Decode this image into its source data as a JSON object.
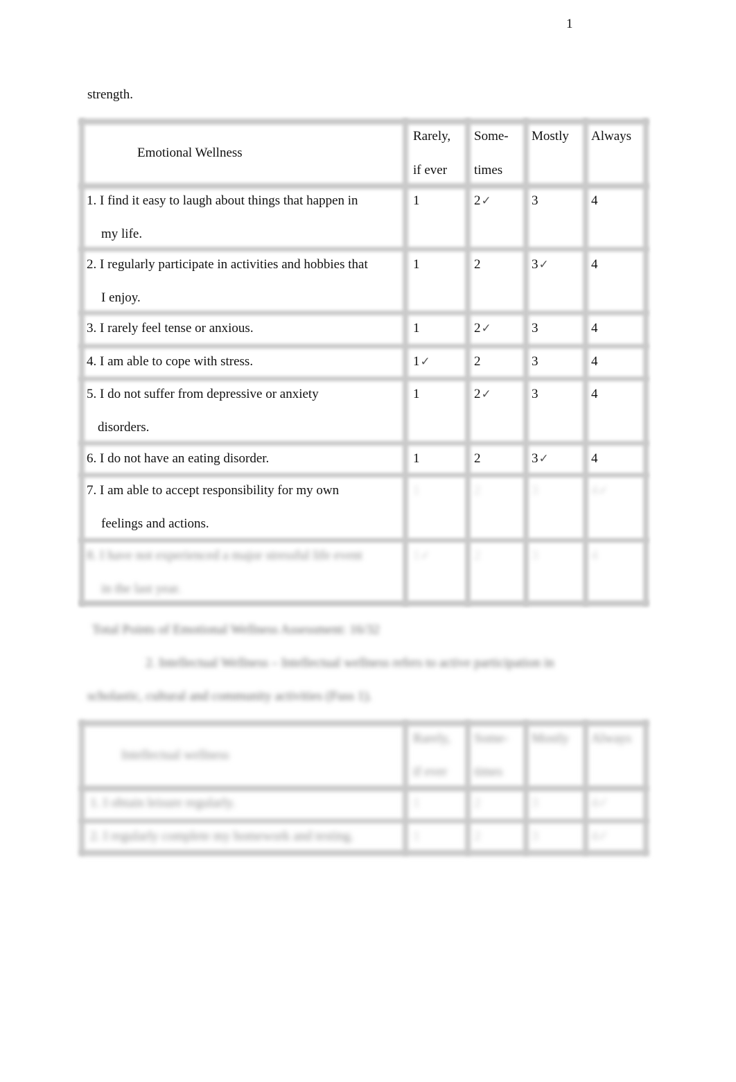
{
  "page": {
    "number": "1",
    "intro_text": "strength."
  },
  "emotional_table": {
    "title": "Emotional Wellness",
    "columns": [
      {
        "line1": "Rarely,",
        "line2": "if ever"
      },
      {
        "line1": "Some-",
        "line2": "times"
      },
      {
        "line1": "Mostly",
        "line2": ""
      },
      {
        "line1": "Always",
        "line2": ""
      }
    ],
    "check_glyph": "✓",
    "rows": [
      {
        "line1": "1. I find it easy to laugh about things that happen in",
        "line2": "my life.",
        "values": [
          "1",
          "2",
          "3",
          "4"
        ],
        "checked": 1
      },
      {
        "line1": "2. I regularly participate in activities and hobbies that",
        "line2": "I enjoy.",
        "values": [
          "1",
          "2",
          "3",
          "4"
        ],
        "checked": 2
      },
      {
        "line1": "3. I rarely feel tense or anxious.",
        "line2": "",
        "values": [
          "1",
          "2",
          "3",
          "4"
        ],
        "checked": 1
      },
      {
        "line1": "4. I am able to cope with stress.",
        "line2": "",
        "values": [
          "1",
          "2",
          "3",
          "4"
        ],
        "checked": 0
      },
      {
        "line1": "5. I do not suffer from depressive or anxiety",
        "line2": "disorders.",
        "values": [
          "1",
          "2",
          "3",
          "4"
        ],
        "checked": 1
      },
      {
        "line1": "6. I do not have an eating disorder.",
        "line2": "",
        "values": [
          "1",
          "2",
          "3",
          "4"
        ],
        "checked": 2
      },
      {
        "line1": "7. I am able to accept responsibility for my own",
        "line2": "feelings and actions.",
        "values": [
          "1",
          "2",
          "3",
          "4"
        ],
        "checked": 3,
        "values_obscured": true
      },
      {
        "line1": "8. I have not experienced a major stressful life event",
        "line2": "in the last year.",
        "values": [
          "1",
          "2",
          "3",
          "4"
        ],
        "checked": 0,
        "obscured": true
      }
    ]
  },
  "obscured_text": {
    "total": "Total Points of Emotional Wellness Assessment: 16/32",
    "section_heading": "2. Intellectual Wellness – Intellectual wellness refers to active participation in",
    "section_continuation": "scholastic, cultural and community activities (Fuss 1)."
  },
  "intellectual_table": {
    "title": "Intellectual wellness",
    "columns": [
      {
        "line1": "Rarely,",
        "line2": "if ever"
      },
      {
        "line1": "Some-",
        "line2": "times"
      },
      {
        "line1": "Mostly",
        "line2": ""
      },
      {
        "line1": "Always",
        "line2": ""
      }
    ],
    "rows": [
      {
        "line1": "1. I obtain leisure regularly.",
        "values": [
          "1",
          "2",
          "3",
          "4✓"
        ]
      },
      {
        "line1": "2. I regularly complete my homework and testing.",
        "values": [
          "1",
          "2",
          "3",
          "4✓"
        ]
      }
    ]
  }
}
